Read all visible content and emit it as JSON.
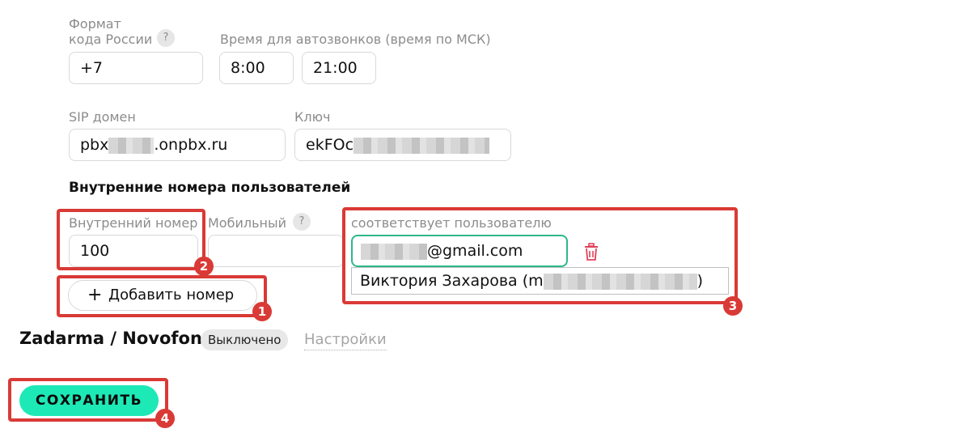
{
  "phone_settings": {
    "country_code_label_line1": "Формат",
    "country_code_label_line2": "кода России",
    "help_glyph": "?",
    "country_code_value": "+7",
    "autocall_time_label": "Время для автозвонков (время по МСК)",
    "autocall_from": "8:00",
    "autocall_to": "21:00",
    "sip_domain_label": "SIP домен",
    "sip_domain_prefix": "pbx",
    "sip_domain_suffix": ".onpbx.ru",
    "key_label": "Ключ",
    "key_prefix": "ekFOc"
  },
  "internal_numbers": {
    "title": "Внутренние номера пользователей",
    "internal_number_label": "Внутренний номер",
    "mobile_label": "Мобильный",
    "user_label": "соответствует пользователю",
    "internal_number_value": "100",
    "user_email_suffix": "@gmail.com",
    "user_suggestion_prefix": "Виктория Захарова (m",
    "user_suggestion_suffix": ")",
    "add_number_label": "Добавить номер",
    "add_glyph": "+"
  },
  "zadarma": {
    "title": "Zadarma / Novofon",
    "status_badge": "Выключено",
    "settings_link": "Настройки"
  },
  "save_label": "СОХРАНИТЬ",
  "annotations": [
    "1",
    "2",
    "3",
    "4"
  ],
  "colors": {
    "accent": "#1de9b6",
    "annotation_red": "#d93a36",
    "focus_border": "#2eb88a",
    "delete_icon": "#e0425a"
  }
}
